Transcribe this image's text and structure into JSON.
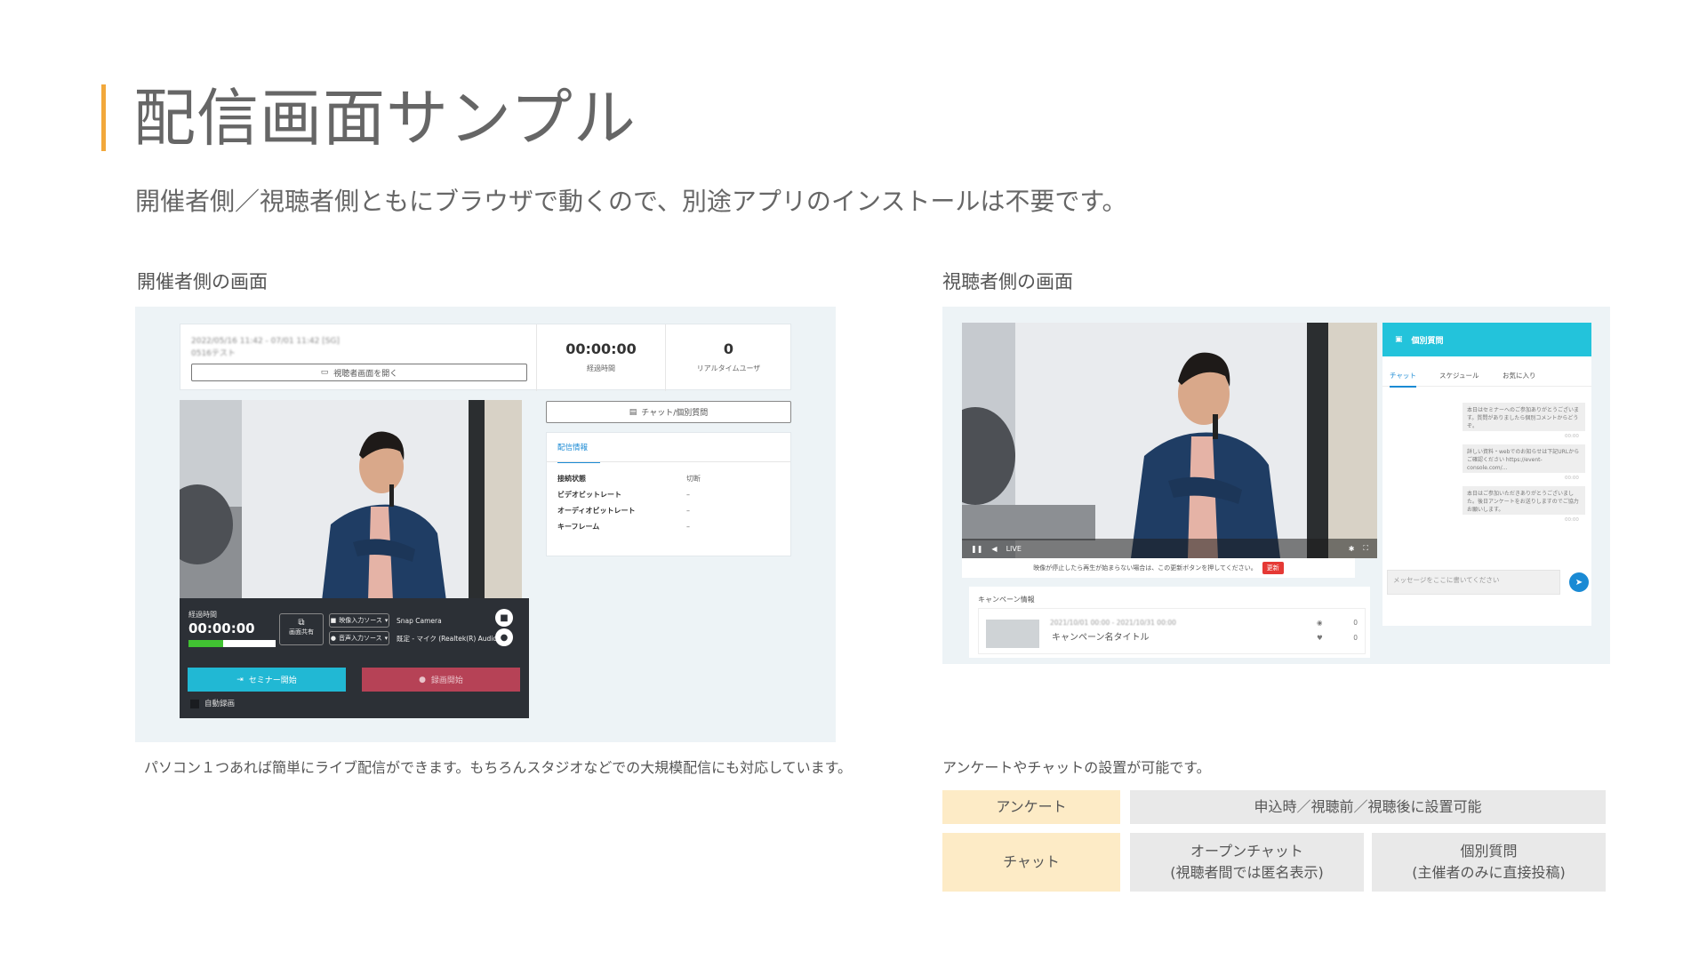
{
  "page": {
    "title": "配信画面サンプル",
    "subtitle": "開催者側／視聴者側ともにブラウザで動くので、別途アプリのインストールは不要です。",
    "accent_color": "#f2a83b"
  },
  "host_section": {
    "label": "開催者側の画面",
    "caption": "パソコン１つあれば簡単にライブ配信ができます。もちろんスタジオなどでの大規模配信にも対応しています。",
    "ui": {
      "date_range": "2022/05/16 11:42 - 07/01 11:42 [SG]",
      "event_name": "0516テスト",
      "open_viewer_button": "視聴者画面を開く",
      "elapsed_value": "00:00:00",
      "elapsed_label": "経過時間",
      "realtime_users_value": "0",
      "realtime_users_label": "リアルタイムユーザ",
      "chat_button": "チャット/個別質問",
      "stream_info_tab": "配信情報",
      "stream_info_rows": [
        {
          "label": "接続状態",
          "value": "切断"
        },
        {
          "label": "ビデオビットレート",
          "value": "–"
        },
        {
          "label": "オーディオビットレート",
          "value": "–"
        },
        {
          "label": "キーフレーム",
          "value": "–"
        }
      ],
      "controls": {
        "time_label": "経過時間",
        "time_value": "00:00:00",
        "audio_level": 0.4,
        "screen_share_label": "画面共有",
        "video_source_button": "映像入力ソース",
        "audio_source_button": "音声入力ソース",
        "video_device": "Snap Camera",
        "audio_device": "既定 - マイク (Realtek(R) Audio)",
        "seminar_start_button": "セミナー開始",
        "record_start_button": "録画開始",
        "auto_record_label": "自動録画",
        "seminar_color": "#21b8d4",
        "record_color": "#b64256"
      }
    }
  },
  "viewer_section": {
    "label": "視聴者側の画面",
    "caption": "アンケートやチャットの設置が可能です。",
    "ui": {
      "live_label": "LIVE",
      "notice_text": "映像が停止したら再生が始まらない場合は、この更新ボタンを押してください。",
      "refresh_button": "更新",
      "campaign_header": "キャンペーン情報",
      "campaign_date": "2021/10/01 00:00 - 2021/10/31 00:00",
      "campaign_name": "キャンペーン名タイトル",
      "campaign_views": "0",
      "campaign_likes": "0",
      "chat_header": "個別質問",
      "tabs": [
        "チャット",
        "スケジュール",
        "お気に入り"
      ],
      "messages": [
        "本日はセミナーへのご参加ありがとうございます。質問がありましたら個別コメントからどうぞ。",
        "詳しい資料・webでのお知らせは下記URLからご確認ください https://event-console.com/...",
        "本日はご参加いただきありがとうございました。後日アンケートをお送りしますのでご協力お願いします。"
      ],
      "message_time": "00:00",
      "input_placeholder": "メッセージをここに書いてください",
      "header_color": "#23c3db"
    }
  },
  "feature_table": {
    "rows": [
      {
        "head": "アンケート",
        "cells": [
          {
            "line1": "申込時／視聴前／視聴後に設置可能",
            "line2": ""
          }
        ]
      },
      {
        "head": "チャット",
        "cells": [
          {
            "line1": "オープンチャット",
            "line2": "(視聴者間では匿名表示)"
          },
          {
            "line1": "個別質問",
            "line2": "(主催者のみに直接投稿)"
          }
        ]
      }
    ],
    "head_color": "#fdebc6",
    "body_color": "#e9e9e9"
  }
}
